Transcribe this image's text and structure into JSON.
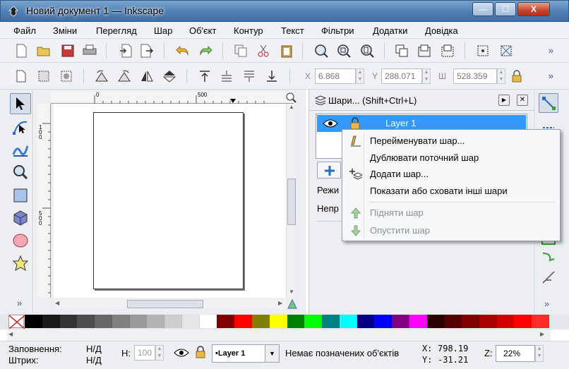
{
  "window": {
    "title": "Новий документ 1 — Inkscape",
    "controls": {
      "minimize": "—",
      "maximize": "☐",
      "close": "X"
    }
  },
  "menu": [
    "Файл",
    "Зміни",
    "Перегляд",
    "Шар",
    "Об'єкт",
    "Контур",
    "Текст",
    "Фільтри",
    "Додатки",
    "Довідка"
  ],
  "toolbar_overflow": "»",
  "coords": {
    "x_label": "X",
    "x_value": "6.868",
    "y_label": "Y",
    "y_value": "288.071",
    "w_label": "Ш",
    "w_value": "528.359"
  },
  "ruler": {
    "h_marks": [
      "0",
      "500"
    ],
    "v_marks": [
      "100",
      "500"
    ]
  },
  "layers_panel": {
    "title": "Шари... (Shift+Ctrl+L)",
    "layer_name": "Layer 1",
    "label_mode": "Режи",
    "label_opacity": "Непр"
  },
  "context_menu": {
    "items": [
      {
        "label": "Перейменувати шар...",
        "enabled": true
      },
      {
        "label": "Дублювати поточний шар",
        "enabled": true
      },
      {
        "label": "Додати шар...",
        "enabled": true
      },
      {
        "label": "Показати або сховати інші шари",
        "enabled": true
      },
      {
        "label": "Підняти шар",
        "enabled": false
      },
      {
        "label": "Опустити шар",
        "enabled": false
      }
    ]
  },
  "palette": {
    "colors": [
      "#000000",
      "#1a1a1a",
      "#333333",
      "#4d4d4d",
      "#666666",
      "#808080",
      "#999999",
      "#b3b3b3",
      "#cccccc",
      "#e6e6e6",
      "#ffffff",
      "#800000",
      "#ff0000",
      "#808000",
      "#ffff00",
      "#008000",
      "#00ff00",
      "#008080",
      "#00ffff",
      "#000080",
      "#0000ff",
      "#800080",
      "#ff00ff",
      "#2b0000",
      "#550000",
      "#800000",
      "#aa0000",
      "#d40000",
      "#ff0000",
      "#ff2a2a"
    ]
  },
  "status": {
    "fill_label": "Заповнення:",
    "fill_value": "Н/Д",
    "stroke_label": "Штрих:",
    "stroke_value": "Н/Д",
    "h_label": "H:",
    "h_value": "100",
    "layer_select": "•Layer 1",
    "message": "Немає позначених об'єктів",
    "x_label": "X:",
    "x_value": "798.19",
    "y_label": "Y:",
    "y_value": "-31.21",
    "zoom_label": "Z:",
    "zoom_value": "22%"
  }
}
